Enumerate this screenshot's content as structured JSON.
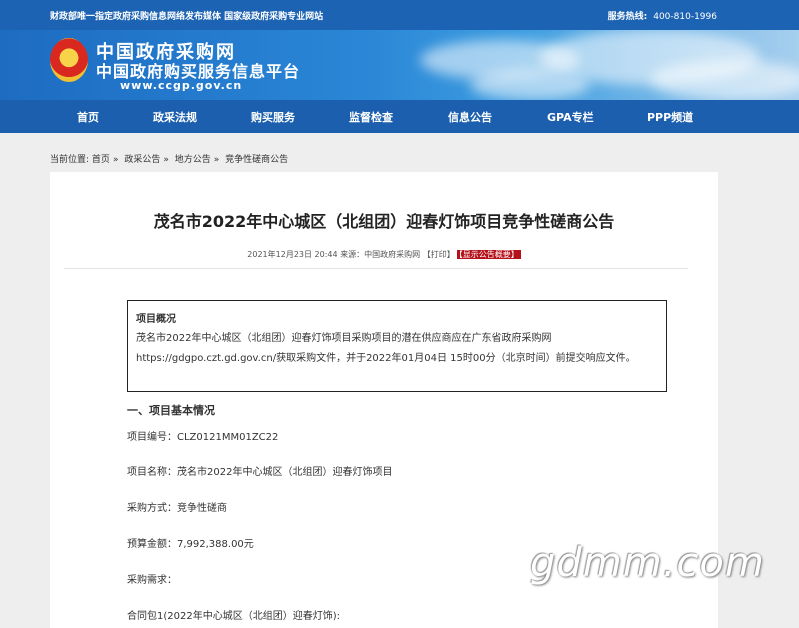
{
  "topbar": {
    "notice": "财政部唯一指定政府采购信息网络发布媒体 国家级政府采购专业网站",
    "hotline_label": "服务热线:",
    "hotline_number": "400-810-1996"
  },
  "banner": {
    "logo_title": "中国政府采购网",
    "logo_subtitle": "中国政府购买服务信息平台",
    "logo_url": "www.ccgp.gov.cn"
  },
  "nav": {
    "items": [
      {
        "label": "首页"
      },
      {
        "label": "政采法规"
      },
      {
        "label": "购买服务"
      },
      {
        "label": "监督检查"
      },
      {
        "label": "信息公告"
      },
      {
        "label": "GPA专栏"
      },
      {
        "label": "PPP频道"
      }
    ]
  },
  "breadcrumb": {
    "prefix": "当前位置:",
    "items": [
      "首页",
      "政采公告",
      "地方公告",
      "竞争性磋商公告"
    ],
    "separator": "»"
  },
  "article": {
    "title": "茂名市2022年中心城区（北组团）迎春灯饰项目竞争性磋商公告",
    "datetime": "2021年12月23日 20:44",
    "source": "来源：中国政府采购网",
    "print": "【打印】",
    "show_summary": "【显示公告概要】",
    "overview": {
      "heading": "项目概况",
      "line1": "茂名市2022年中心城区（北组团）迎春灯饰项目采购项目的潜在供应商应在广东省政府采购网",
      "line2": "https://gdgpo.czt.gd.gov.cn/获取采购文件，并于2022年01月04日 15时00分（北京时间）前提交响应文件。"
    },
    "section1_title": "一、项目基本情况",
    "fields": [
      "项目编号：CLZ0121MM01ZC22",
      "项目名称：茂名市2022年中心城区（北组团）迎春灯饰项目",
      "采购方式：竞争性磋商",
      "预算金额：7,992,388.00元",
      "采购需求：",
      "合同包1(2022年中心城区（北组团）迎春灯饰):"
    ]
  },
  "watermark": "gdmm.com"
}
